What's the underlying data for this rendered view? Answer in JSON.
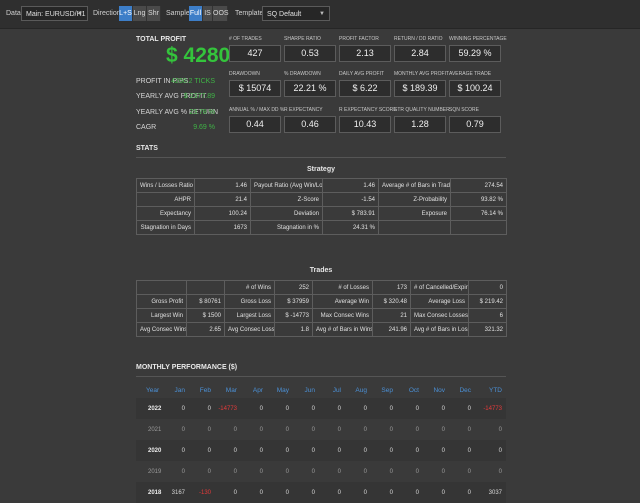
{
  "toolbar": {
    "data_label": "Data",
    "data_value": "Main: EURUSD/H1",
    "direction_label": "Direction",
    "direction_options": [
      "L+S",
      "Lng",
      "Shr"
    ],
    "sample_label": "Sample",
    "sample_options": [
      "Full",
      "IS",
      "OOS"
    ],
    "template_label": "Template",
    "template_value": "SQ Default"
  },
  "summary": {
    "total_profit_label": "TOTAL PROFIT",
    "total_profit_value": "$ 42802",
    "side": [
      {
        "label": "PROFIT IN PIPS",
        "value": "4260.2 TICKS"
      },
      {
        "label": "YEARLY AVG PROFIT",
        "value": "$ 2377.89"
      },
      {
        "label": "YEARLY AVG % RETURN",
        "value": "23.78 %"
      },
      {
        "label": "CAGR",
        "value": "9.69 %"
      }
    ],
    "metrics": [
      {
        "label": "# OF TRADES",
        "value": "427"
      },
      {
        "label": "SHARPE RATIO",
        "value": "0.53"
      },
      {
        "label": "PROFIT FACTOR",
        "value": "2.13"
      },
      {
        "label": "RETURN / DD RATIO",
        "value": "2.84"
      },
      {
        "label": "WINNING PERCENTAGE",
        "value": "59.29 %"
      },
      {
        "label": "DRAWDOWN",
        "value": "$ 15074"
      },
      {
        "label": "% DRAWDOWN",
        "value": "22.21 %"
      },
      {
        "label": "DAILY AVG PROFIT",
        "value": "$ 6.22"
      },
      {
        "label": "MONTHLY AVG PROFIT",
        "value": "$ 189.39"
      },
      {
        "label": "AVERAGE TRADE",
        "value": "$ 100.24"
      },
      {
        "label": "ANNUAL % / MAX DD %",
        "value": "0.44"
      },
      {
        "label": "R EXPECTANCY",
        "value": "0.46"
      },
      {
        "label": "R EXPECTANCY SCORE",
        "value": "10.43"
      },
      {
        "label": "STR QUALITY NUMBER",
        "value": "1.28"
      },
      {
        "label": "SQN SCORE",
        "value": "0.79"
      }
    ]
  },
  "stats": {
    "title": "STATS",
    "strategy_title": "Strategy",
    "strategy_rows": [
      [
        "Wins / Losses Ratio",
        "1.46",
        "Payout Ratio (Avg Win/Loss)",
        "1.46",
        "Average # of Bars in Trade",
        "274.54"
      ],
      [
        "AHPR",
        "21.4",
        "Z-Score",
        "-1.54",
        "Z-Probability",
        "93.82 %"
      ],
      [
        "Expectancy",
        "100.24",
        "Deviation",
        "$ 783.91",
        "Exposure",
        "76.14 %"
      ],
      [
        "Stagnation in Days",
        "1673",
        "Stagnation in %",
        "24.31 %",
        "",
        ""
      ]
    ],
    "trades_title": "Trades",
    "trades_rows": [
      [
        "",
        "",
        "# of Wins",
        "252",
        "# of Losses",
        "173",
        "# of Cancelled/Expired",
        "0"
      ],
      [
        "Gross Profit",
        "$ 80761",
        "Gross Loss",
        "$ 37959",
        "Average Win",
        "$ 320.48",
        "Average Loss",
        "$ 219.42"
      ],
      [
        "Largest Win",
        "$ 1500",
        "Largest Loss",
        "$ -14773",
        "Max Consec Wins",
        "21",
        "Max Consec Losses",
        "6"
      ],
      [
        "Avg Consec Wins",
        "2.65",
        "Avg Consec Loss",
        "1.8",
        "Avg # of Bars in Wins",
        "241.96",
        "Avg # of Bars in Losses",
        "321.32"
      ]
    ]
  },
  "monthly": {
    "title": "MONTHLY PERFORMANCE ($)",
    "headers": [
      "Year",
      "Jan",
      "Feb",
      "Mar",
      "Apr",
      "May",
      "Jun",
      "Jul",
      "Aug",
      "Sep",
      "Oct",
      "Nov",
      "Dec",
      "YTD"
    ],
    "rows": [
      {
        "cells": [
          "2022",
          "0",
          "0",
          "-14773",
          "0",
          "0",
          "0",
          "0",
          "0",
          "0",
          "0",
          "0",
          "0",
          "-14773"
        ],
        "dim": false
      },
      {
        "cells": [
          "2021",
          "0",
          "0",
          "0",
          "0",
          "0",
          "0",
          "0",
          "0",
          "0",
          "0",
          "0",
          "0",
          "0"
        ],
        "dim": true
      },
      {
        "cells": [
          "2020",
          "0",
          "0",
          "0",
          "0",
          "0",
          "0",
          "0",
          "0",
          "0",
          "0",
          "0",
          "0",
          "0"
        ],
        "dim": false
      },
      {
        "cells": [
          "2019",
          "0",
          "0",
          "0",
          "0",
          "0",
          "0",
          "0",
          "0",
          "0",
          "0",
          "0",
          "0",
          "0"
        ],
        "dim": true
      },
      {
        "cells": [
          "2018",
          "3167",
          "-130",
          "0",
          "0",
          "0",
          "0",
          "0",
          "0",
          "0",
          "0",
          "0",
          "0",
          "3037"
        ],
        "dim": false
      }
    ]
  },
  "colors": {
    "accent": "#3d7ec8",
    "profit_green": "#34c43c",
    "negative_red": "#e53a3a",
    "header_blue": "#4b90d6"
  }
}
